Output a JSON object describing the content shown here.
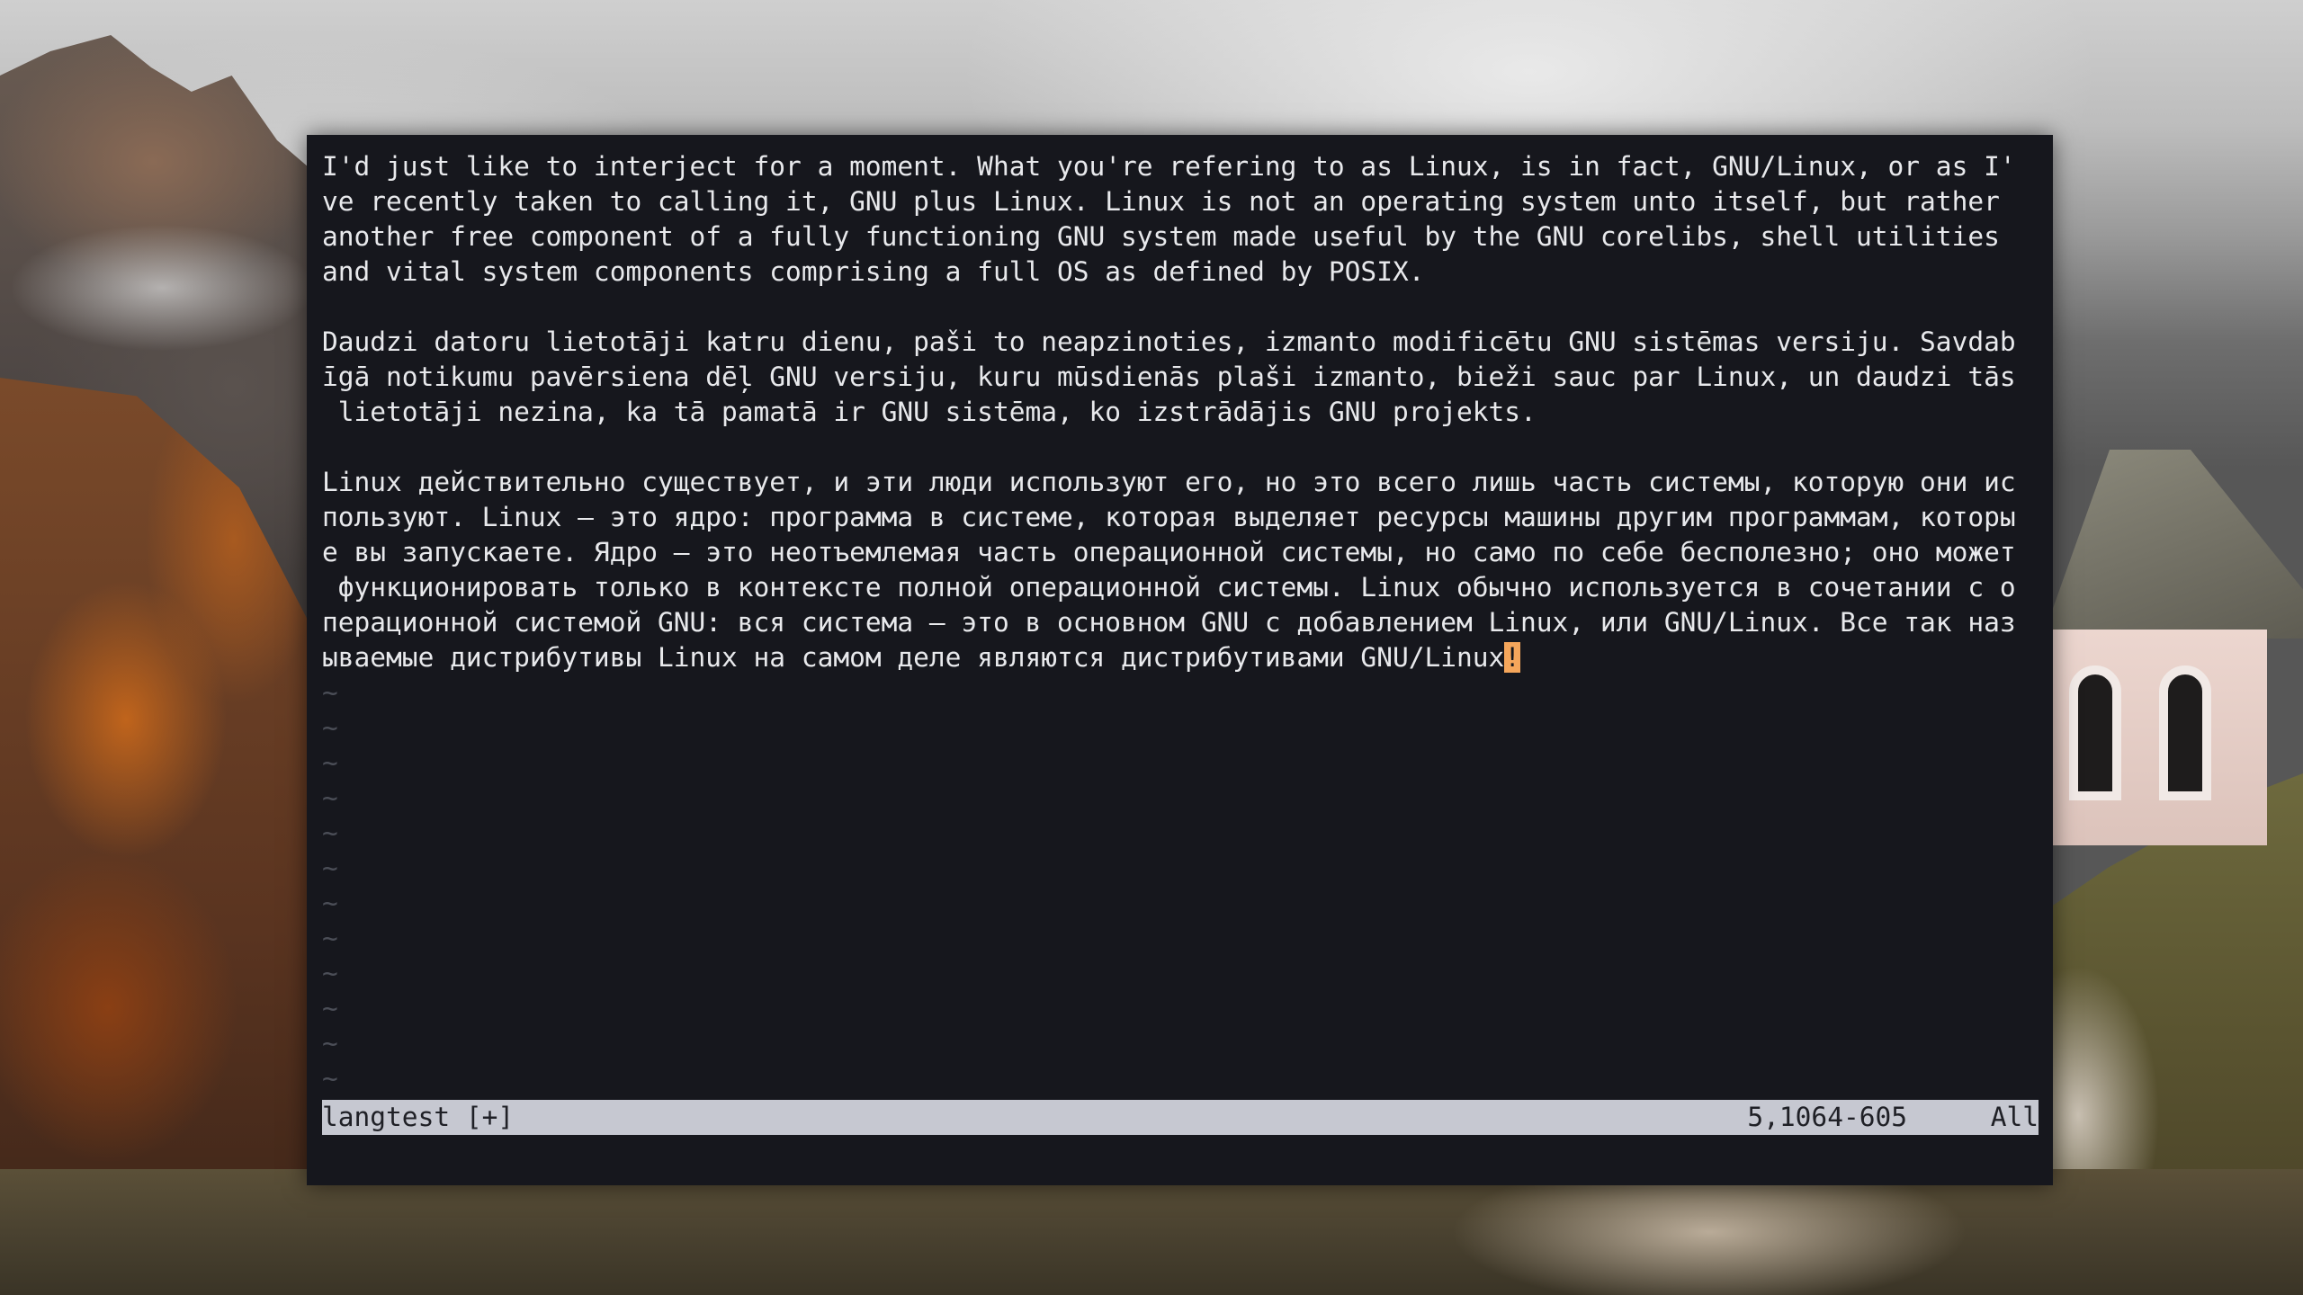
{
  "editor": {
    "lines": [
      "I'd just like to interject for a moment. What you're refering to as Linux, is in fact, GNU/Linux, or as I'",
      "ve recently taken to calling it, GNU plus Linux. Linux is not an operating system unto itself, but rather",
      "another free component of a fully functioning GNU system made useful by the GNU corelibs, shell utilities",
      "and vital system components comprising a full OS as defined by POSIX.",
      "",
      "Daudzi datoru lietotāji katru dienu, paši to neapzinoties, izmanto modificētu GNU sistēmas versiju. Savdab",
      "īgā notikumu pavērsiena dēļ GNU versiju, kuru mūsdienās plaši izmanto, bieži sauc par Linux, un daudzi tās",
      " lietotāji nezina, ka tā pamatā ir GNU sistēma, ko izstrādājis GNU projekts.",
      "",
      "Linux действительно существует, и эти люди используют его, но это всего лишь часть системы, которую они ис",
      "пользуют. Linux — это ядро: программа в системе, которая выделяет ресурсы машины другим программам, которы",
      "е вы запускаете. Ядро — это неотъемлемая часть операционной системы, но само по себе бесполезно; оно может",
      " функционировать только в контексте полной операционной системы. Linux обычно используется в сочетании с о",
      "перационной системой GNU: вся система — это в основном GNU с добавлением Linux, или GNU/Linux. Все так наз"
    ],
    "last_line_text": "ываемые дистрибутивы Linux на самом деле являются дистрибутивами GNU/Linux",
    "cursor_char": "!",
    "empty_line_marker": "~",
    "empty_lines_count": 12
  },
  "statusline": {
    "filename": "langtest [+]",
    "position": "5,1064-605",
    "scroll": "All"
  },
  "colors": {
    "terminal_bg": "#16171d",
    "text": "#e8e9ec",
    "cursor": "#f5a65b",
    "statusline_bg": "#c6c8d1",
    "tilde": "#4b4e57"
  }
}
